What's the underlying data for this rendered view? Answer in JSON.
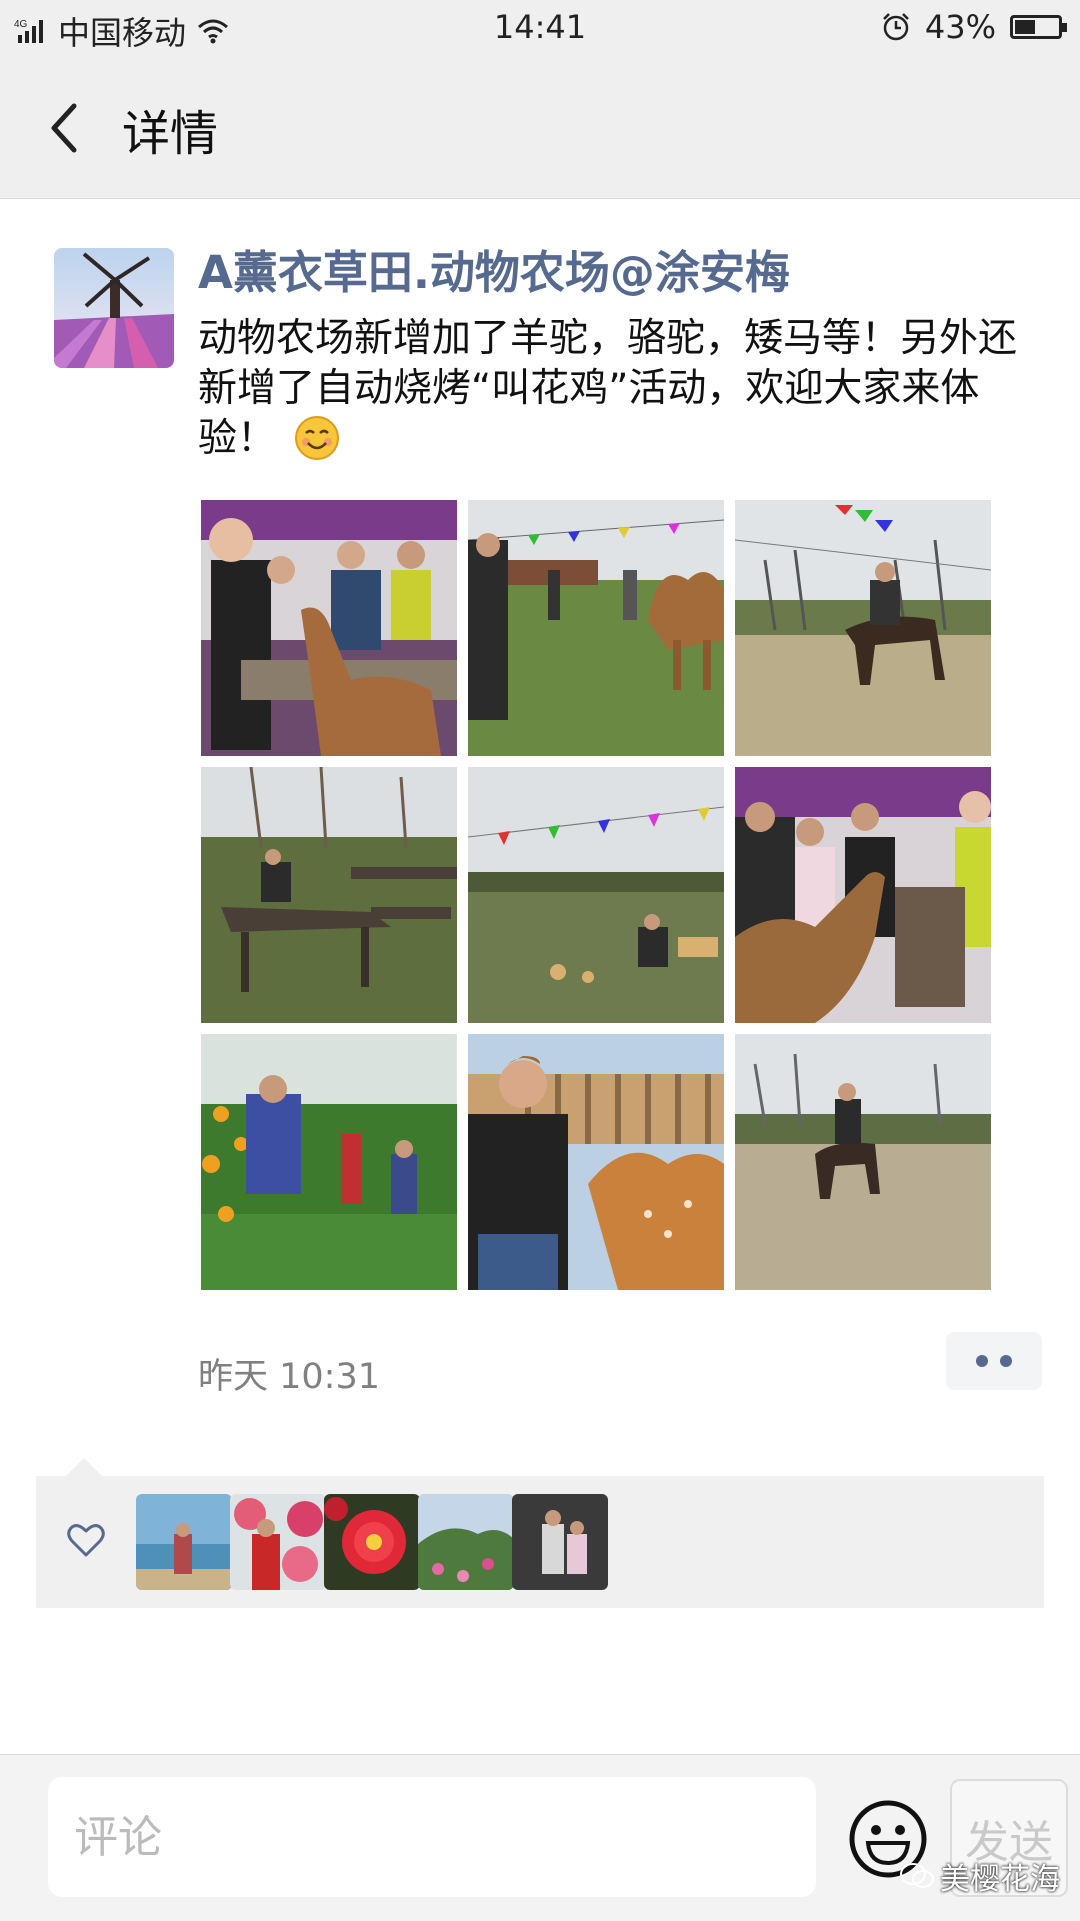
{
  "status_bar": {
    "network": "4G",
    "carrier": "中国移动",
    "time": "14:41",
    "battery_percent": "43%",
    "battery_level": 0.43,
    "icons": [
      "signal-icon",
      "wifi-icon",
      "alarm-icon",
      "battery-icon"
    ]
  },
  "nav": {
    "title": "详情",
    "back_icon": "chevron-left-icon"
  },
  "post": {
    "author": "A薰衣草田.动物农场@涂安梅",
    "text": "动物农场新增加了羊驼，骆驼，矮马等！另外还新增了自动烧烤“叫花鸡”活动，欢迎大家来体验！",
    "emoji": "smile-emoji",
    "timestamp": "昨天 10:31",
    "photos": [
      "alpaca-feeding-photo",
      "camel-field-photo",
      "horse-riding-photo",
      "picnic-table-photo",
      "field-bbq-photo",
      "alpaca-crowd-photo",
      "orange-orchard-photo",
      "deer-feeding-photo",
      "pony-riding-photo"
    ]
  },
  "likes": {
    "icon": "heart-icon",
    "avatars": [
      "beach-avatar",
      "red-flowers-avatar",
      "red-camellia-avatar",
      "hill-flowers-avatar",
      "couple-avatar"
    ]
  },
  "comment_bar": {
    "placeholder": "评论",
    "send_label": "发送",
    "emoji_icon": "emoji-icon"
  },
  "watermark": "美樱花海"
}
